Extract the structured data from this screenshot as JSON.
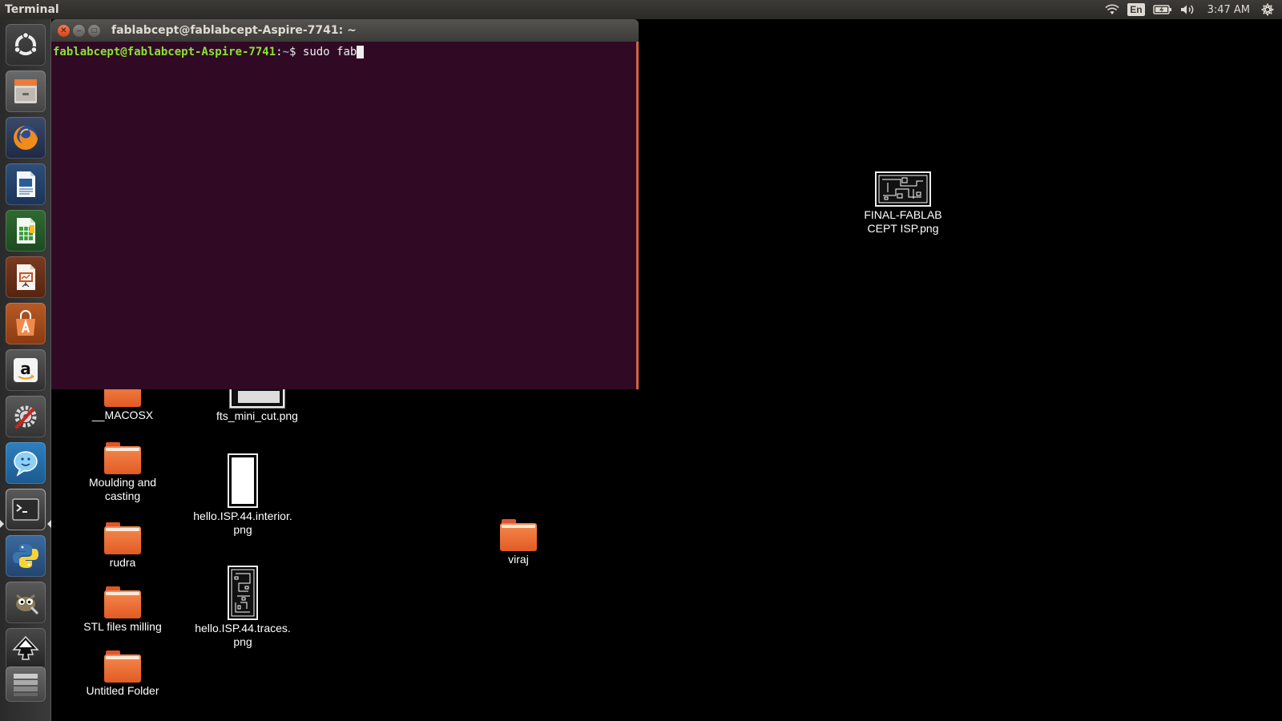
{
  "top_panel": {
    "app_title": "Terminal",
    "keyboard_layout": "En",
    "clock": "3:47 AM",
    "indicators": [
      "wifi-icon",
      "keyboard-layout",
      "battery-icon",
      "volume-icon",
      "clock",
      "gear-icon"
    ]
  },
  "launcher": {
    "items": [
      {
        "name": "dash-home",
        "icon": "ubuntu-logo-icon"
      },
      {
        "name": "files",
        "icon": "file-cabinet-icon"
      },
      {
        "name": "firefox",
        "icon": "firefox-icon"
      },
      {
        "name": "libreoffice-writer",
        "icon": "writer-icon"
      },
      {
        "name": "libreoffice-calc",
        "icon": "calc-icon"
      },
      {
        "name": "libreoffice-impress",
        "icon": "impress-icon"
      },
      {
        "name": "ubuntu-software-center",
        "icon": "software-center-icon"
      },
      {
        "name": "amazon",
        "icon": "amazon-icon"
      },
      {
        "name": "system-settings",
        "icon": "settings-icon"
      },
      {
        "name": "empathy",
        "icon": "chat-icon"
      },
      {
        "name": "terminal",
        "icon": "terminal-icon",
        "active": true
      },
      {
        "name": "python",
        "icon": "python-icon"
      },
      {
        "name": "gimp",
        "icon": "gimp-icon"
      },
      {
        "name": "inkscape",
        "icon": "inkscape-icon"
      },
      {
        "name": "workspaces",
        "icon": "workspaces-icon"
      }
    ],
    "colors": {
      "accent": "#dd4814"
    }
  },
  "terminal": {
    "title": "fablabcept@fablabcept-Aspire-7741: ~",
    "prompt_user": "fablabcept@fablabcept-Aspire-7741",
    "prompt_colon": ":",
    "prompt_path": "~",
    "prompt_dollar": "$",
    "command": " sudo fab",
    "colors": {
      "background": "#300a24",
      "user": "#8ae234",
      "path": "#729fcf"
    }
  },
  "desktop": {
    "icons": [
      {
        "label": "__MACOSX",
        "type": "folder"
      },
      {
        "label": "fts_mini_cut.png",
        "type": "image"
      },
      {
        "label": "Moulding and casting",
        "type": "folder"
      },
      {
        "label": "hello.ISP.44.interior.\npng",
        "type": "image"
      },
      {
        "label": "rudra",
        "type": "folder"
      },
      {
        "label": "STL files milling",
        "type": "folder"
      },
      {
        "label": "hello.ISP.44.traces.\npng",
        "type": "image"
      },
      {
        "label": "Untitled Folder",
        "type": "folder"
      },
      {
        "label": "viraj",
        "type": "folder"
      },
      {
        "label": "FINAL-FABLAB CEPT ISP.png",
        "type": "image"
      }
    ]
  }
}
